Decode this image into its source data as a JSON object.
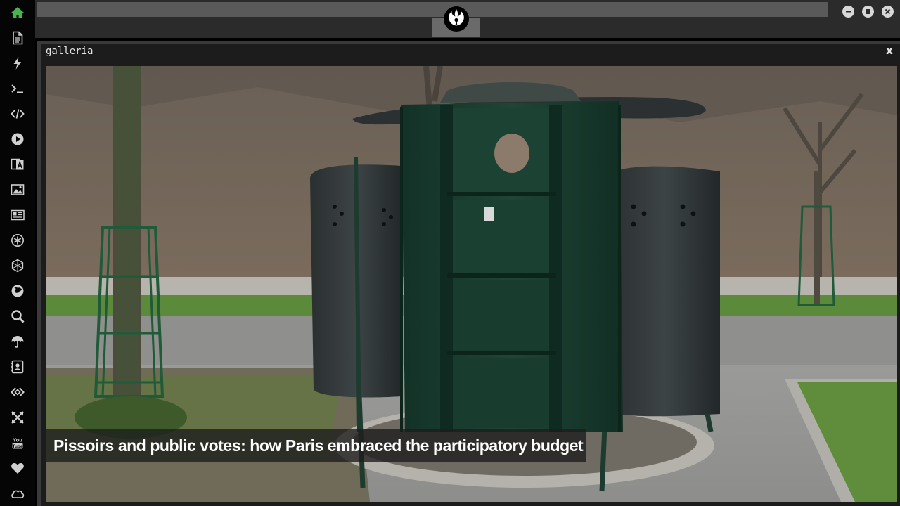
{
  "sidebar": {
    "items": [
      {
        "icon": "home-icon",
        "color": "#4caf50"
      },
      {
        "icon": "document-icon",
        "color": "#d0d0d0"
      },
      {
        "icon": "lightning-icon",
        "color": "#d0d0d0"
      },
      {
        "icon": "terminal-icon",
        "color": "#d0d0d0"
      },
      {
        "icon": "code-icon",
        "color": "#d0d0d0"
      },
      {
        "icon": "play-icon",
        "color": "#d0d0d0"
      },
      {
        "icon": "translate-icon",
        "color": "#d0d0d0"
      },
      {
        "icon": "image-icon",
        "color": "#d0d0d0"
      },
      {
        "icon": "newspaper-icon",
        "color": "#d0d0d0"
      },
      {
        "icon": "asterisk-circle-icon",
        "color": "#d0d0d0"
      },
      {
        "icon": "hexagon-icon",
        "color": "#d0d0d0"
      },
      {
        "icon": "globe-icon",
        "color": "#d0d0d0"
      },
      {
        "icon": "search-icon",
        "color": "#d0d0d0"
      },
      {
        "icon": "umbrella-icon",
        "color": "#d0d0d0"
      },
      {
        "icon": "contact-card-icon",
        "color": "#d0d0d0"
      },
      {
        "icon": "code-diamond-icon",
        "color": "#d0d0d0"
      },
      {
        "icon": "expand-arrows-icon",
        "color": "#d0d0d0"
      },
      {
        "icon": "youtube-icon",
        "color": "#d0d0d0"
      },
      {
        "icon": "heart-icon",
        "color": "#d0d0d0"
      },
      {
        "icon": "cloud-icon",
        "color": "#d0d0d0"
      }
    ]
  },
  "window": {
    "emblem_icon": "rebel-alliance-icon",
    "controls": [
      "minimize-icon",
      "maximize-icon",
      "close-icon"
    ]
  },
  "panel": {
    "title": "galleria",
    "close_label": "x"
  },
  "gallery": {
    "caption": "Pissoirs and public votes: how Paris embraced the participatory budget"
  },
  "colors": {
    "accent_green": "#4caf50",
    "topbar": "#2b2b2b",
    "panel": "#1c1c1c"
  }
}
